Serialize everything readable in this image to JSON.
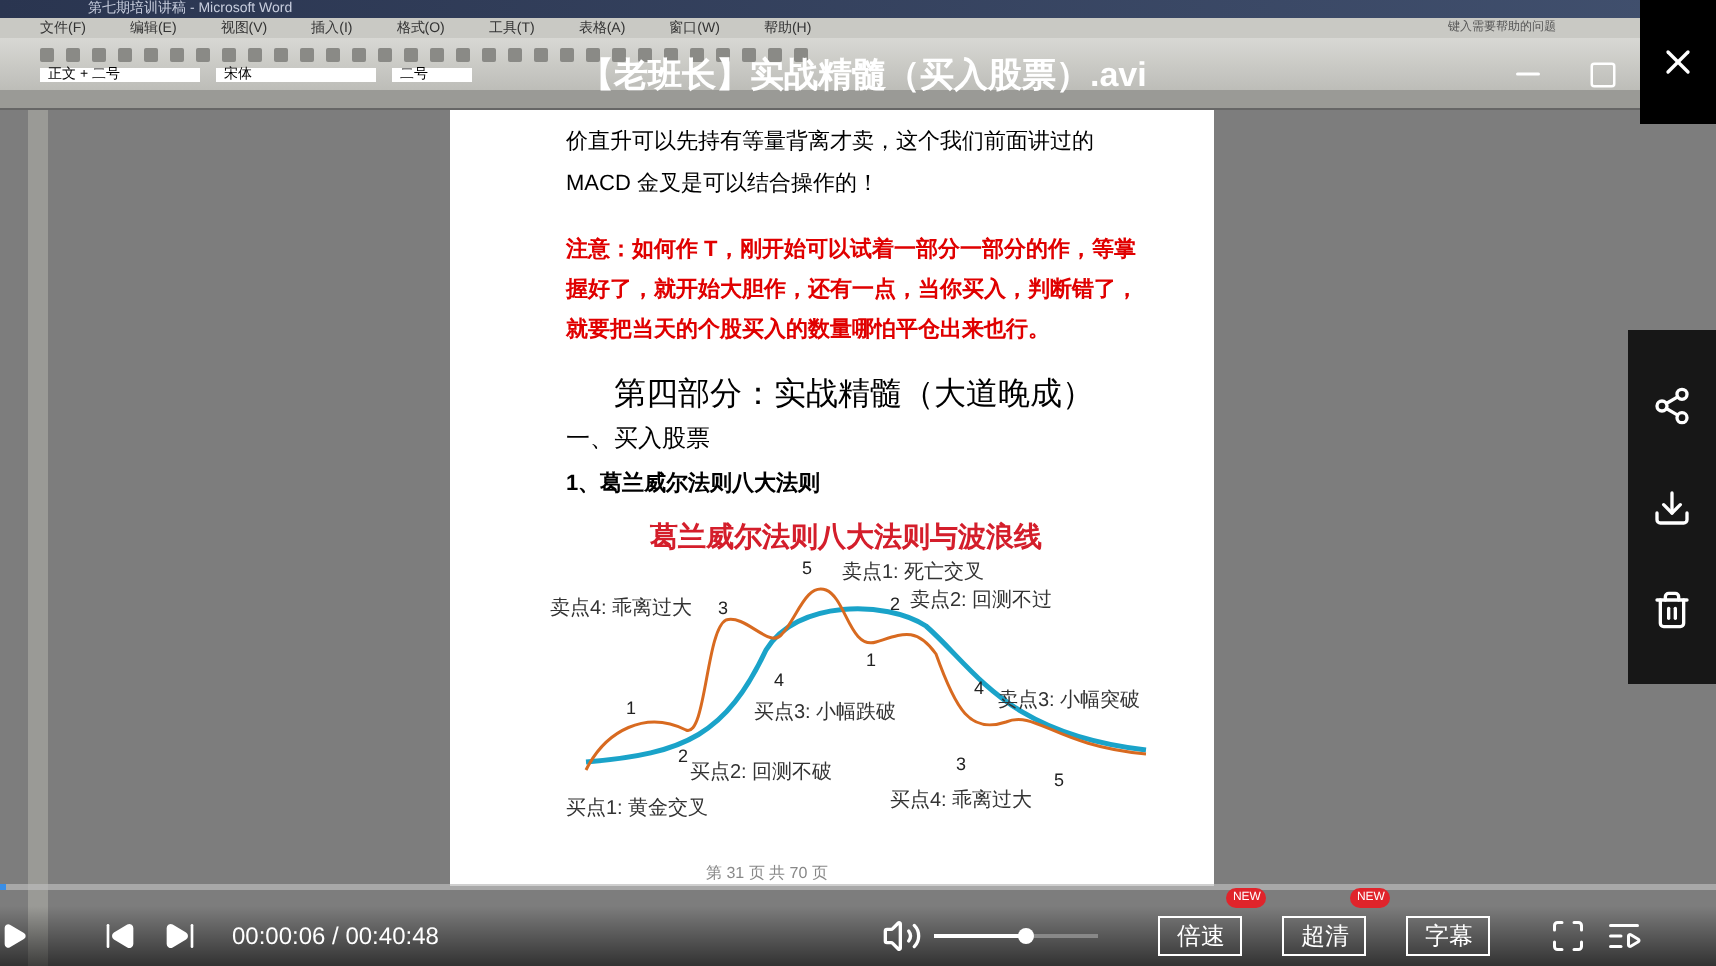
{
  "video_title": "【老班长】实战精髓（买入股票）.avi",
  "word": {
    "title": "第七期培训讲稿 - Microsoft Word",
    "menus": [
      "文件(F)",
      "编辑(E)",
      "视图(V)",
      "插入(I)",
      "格式(O)",
      "工具(T)",
      "表格(A)",
      "窗口(W)",
      "帮助(H)"
    ],
    "help_box": "键入需要帮助的问题",
    "style_box": "正文 + 二号",
    "font_box": "宋体",
    "size_box": "二号",
    "document": {
      "paragraphs": [
        {
          "kind": "body",
          "text": "价直升可以先持有等量背离才卖，这个我们前面讲过的 MACD 金叉是可以结合操作的！"
        },
        {
          "kind": "note",
          "text": "注意：如何作 T，刚开始可以试着一部分一部分的作，等掌握好了，就开始大胆作，还有一点，当你买入，判断错了，就要把当天的个股买入的数量哪怕平仓出来也行。"
        },
        {
          "kind": "heading",
          "text": "第四部分：实战精髓（大道晚成）"
        },
        {
          "kind": "subheading",
          "text": "一、买入股票"
        },
        {
          "kind": "item",
          "text": "1、葛兰威尔法则八大法则"
        }
      ],
      "figure": {
        "title": "葛兰威尔法则八大法则与波浪线",
        "labels": [
          "卖点4: 乖离过大",
          "卖点1: 死亡交叉",
          "卖点2: 回测不过",
          "买点3: 小幅跌破",
          "卖点3: 小幅突破",
          "买点2: 回测不破",
          "买点1: 黄金交叉",
          "买点4: 乖离过大"
        ],
        "wave_numbers": [
          "1",
          "2",
          "3",
          "4",
          "5",
          "1",
          "2",
          "3",
          "4",
          "5"
        ]
      },
      "page_footer": "第 31 页 共 70 页"
    }
  },
  "player": {
    "time": "00:00:06 / 00:40:48",
    "progress": {
      "level": 0.003
    },
    "volume": {
      "level": 0.55
    },
    "buttons": [
      {
        "label": "倍速",
        "badge": "NEW"
      },
      {
        "label": "超清",
        "badge": "NEW"
      },
      {
        "label": "字幕"
      }
    ]
  }
}
